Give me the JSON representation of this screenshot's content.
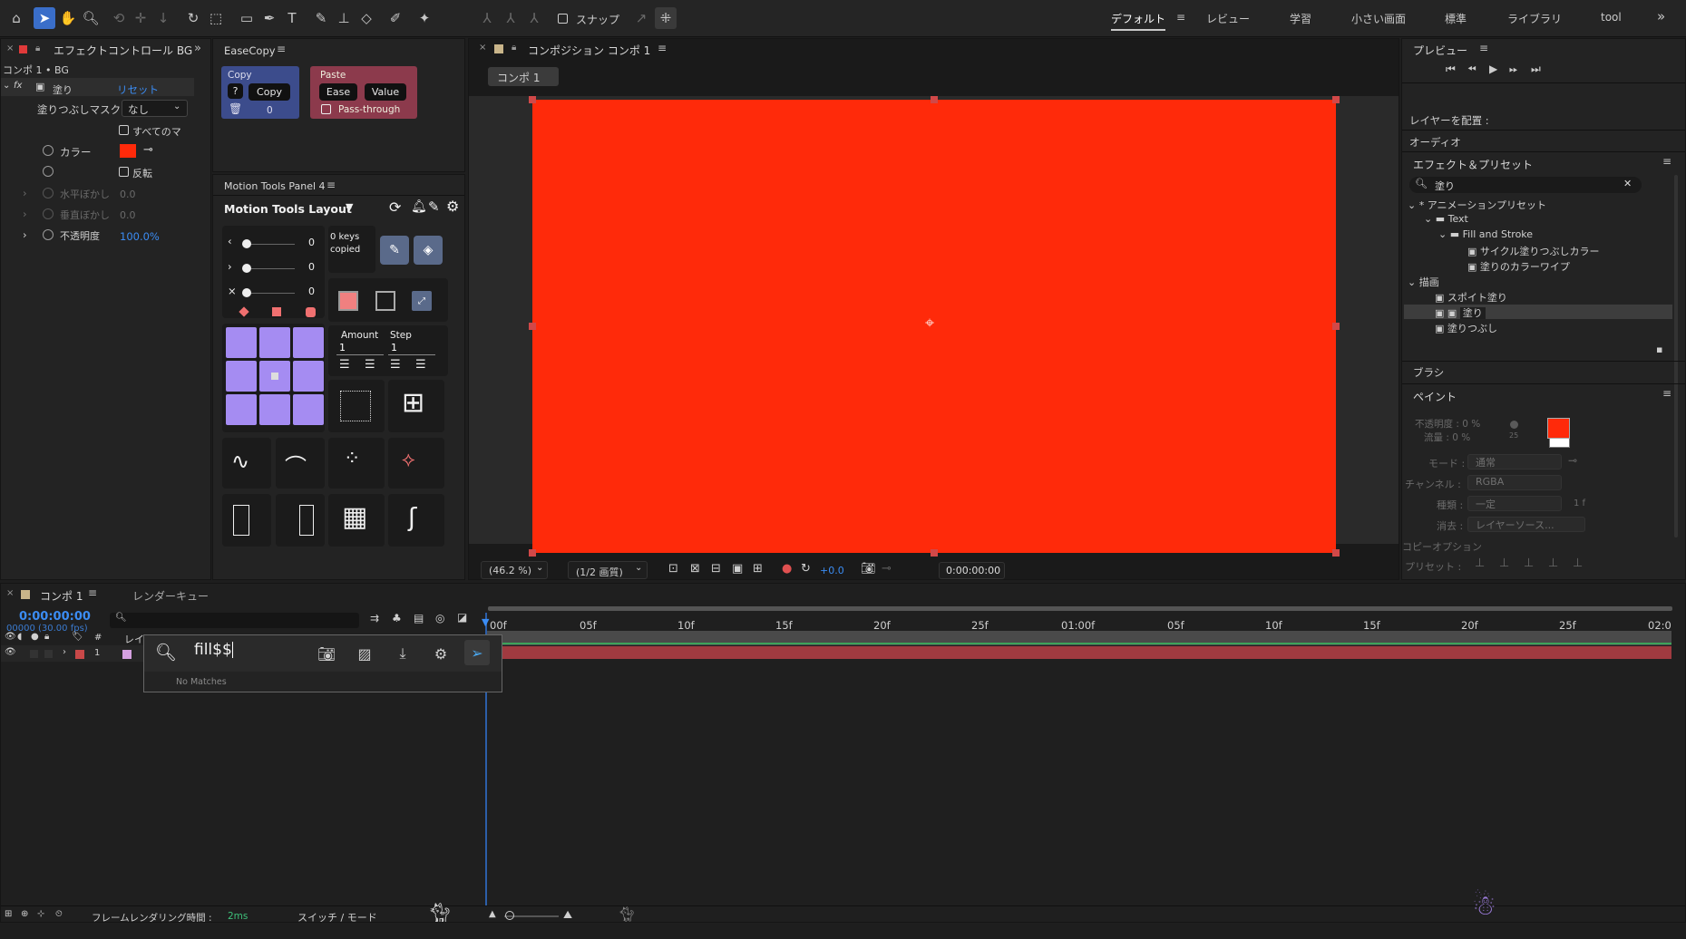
{
  "toolbar": {
    "snap_label": "スナップ",
    "workspaces": [
      "デフォルト",
      "レビュー",
      "学習",
      "小さい画面",
      "標準",
      "ライブラリ",
      "tool"
    ],
    "more_glyph": "»"
  },
  "effect_controls": {
    "tab_title": "エフェクトコントロール BG",
    "layer_path": "コンポ 1 • BG",
    "effect_name": "塗り",
    "reset_label": "リセット",
    "fill_mask_label": "塗りつぶしマスク",
    "fill_mask_value": "なし",
    "all_masks_label": "すべてのマ",
    "color_label": "カラー",
    "invert_label": "反転",
    "h_feather_label": "水平ぼかし",
    "h_feather_value": "0.0",
    "v_feather_label": "垂直ぼかし",
    "v_feather_value": "0.0",
    "opacity_label": "不透明度",
    "opacity_value": "100.0%",
    "color_value": "#ff2a0a"
  },
  "easecopy": {
    "title": "EaseCopy",
    "copy_group": "Copy",
    "question_label": "?",
    "copy_button": "Copy",
    "count_value": "0",
    "paste_group": "Paste",
    "ease_button": "Ease",
    "value_button": "Value",
    "passthrough_label": "Pass-through"
  },
  "motion_tools": {
    "title": "Motion Tools Panel 4",
    "layout_label": "Motion Tools Layout",
    "slider_values": [
      "0",
      "0",
      "0"
    ],
    "keys_copied_line1": "0 keys",
    "keys_copied_line2": "copied",
    "amount_label": "Amount",
    "step_label": "Step",
    "amount_value": "1",
    "step_value": "1"
  },
  "composition": {
    "tab_title": "コンポジション コンポ 1",
    "comp_chip": "コンポ 1",
    "zoom_value": "(46.2 %)",
    "resolution_value": "(1/2 画質)",
    "exposure_value": "+0.0",
    "timecode_value": "0:00:00:00",
    "canvas_color": "#ff2a0a"
  },
  "preview_panel": {
    "title": "プレビュー",
    "place_layer_label": "レイヤーを配置 :",
    "audio_label": "オーディオ",
    "effects_presets_title": "エフェクト＆プリセット",
    "search_value": "塗り",
    "tree": [
      "* アニメーションプリセット",
      "Text",
      "Fill and Stroke",
      "サイクル塗りつぶしカラー",
      "塗りのカラーワイプ",
      "描画",
      "スポイト塗り",
      "塗り",
      "塗りつぶし"
    ],
    "brush_label": "ブラシ",
    "paint_title": "ペイント",
    "opacity_label": "不透明度 : 0 %",
    "flow_label": "流量 : 0 %",
    "brush_size": "25",
    "mode_label": "モード :",
    "mode_value": "通常",
    "channel_label": "チャンネル :",
    "channel_value": "RGBA",
    "kind_label": "種類 :",
    "kind_value": "一定",
    "kind_unit": "1 f",
    "erase_label": "消去 :",
    "erase_value": "レイヤーソース...",
    "copy_option_label": "コピーオプション",
    "preset_label": "プリセット :",
    "paint_fg": "#ff2a0a",
    "paint_bg": "#ffffff"
  },
  "timeline": {
    "tab_title": "コンポ 1",
    "render_queue_tab": "レンダーキュー",
    "timecode": "0:00:00:00",
    "fps_label": "00000 (30.00 fps)",
    "layer_col": "レイ",
    "layer_index": "1",
    "layer_hash": "#",
    "ruler_labels": [
      "00f",
      "05f",
      "10f",
      "15f",
      "20f",
      "25f",
      "01:00f",
      "05f",
      "10f",
      "15f",
      "20f",
      "25f",
      "02:0"
    ]
  },
  "search_popup": {
    "query": "fill$$",
    "status": "No Matches"
  },
  "status_bar": {
    "render_time_label": "フレームレンダリング時間 :",
    "render_time_value": "2ms",
    "switch_mode_label": "スイッチ / モード"
  }
}
